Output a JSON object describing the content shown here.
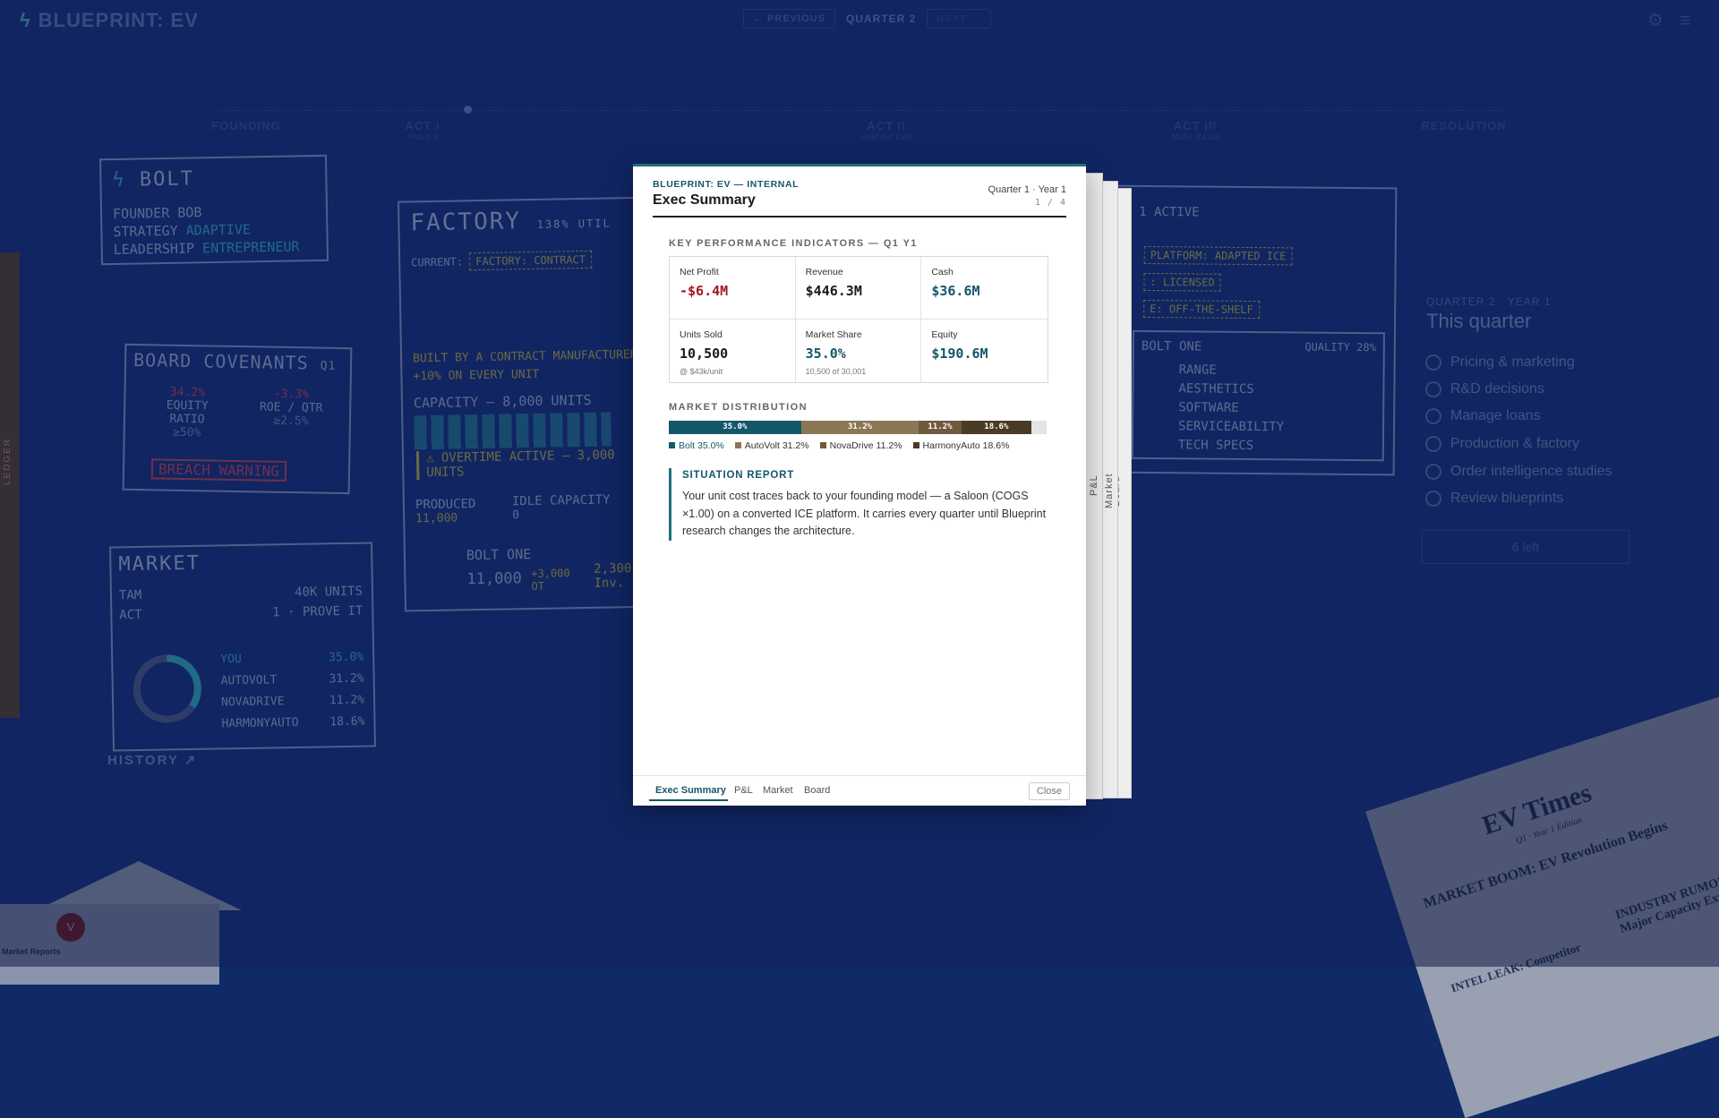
{
  "brand": {
    "name": "BLUEPRINT: EV"
  },
  "topnav": {
    "previous": "← PREVIOUS",
    "quarter": "QUARTER 2",
    "next": "NEXT →"
  },
  "timeline": [
    {
      "label": "FOUNDING",
      "sub": ""
    },
    {
      "label": "ACT I",
      "sub": "Prove It"
    },
    {
      "label": "ACT II",
      "sub": "Hold the Line"
    },
    {
      "label": "ACT III",
      "sub": "Make It Last"
    },
    {
      "label": "RESOLUTION",
      "sub": ""
    }
  ],
  "ledger": {
    "label": "LEDGER"
  },
  "bolt_card": {
    "name": "BOLT",
    "founder_label": "FOUNDER",
    "founder": "BOB",
    "strategy_label": "STRATEGY",
    "strategy": "ADAPTIVE",
    "leadership_label": "LEADERSHIP",
    "leadership": "ENTREPRENEUR"
  },
  "covenants": {
    "title": "BOARD COVENANTS",
    "quarter": "Q1",
    "equity_ratio": "34.2%",
    "equity_label": "EQUITY RATIO",
    "equity_req": "≥50%",
    "roe": "-3.3%",
    "roe_label": "ROE / QTR",
    "roe_req": "≥2.5%",
    "warning": "BREACH WARNING"
  },
  "factory": {
    "title": "FACTORY",
    "util": "138% UTIL",
    "current_label": "CURRENT:",
    "current": "FACTORY: CONTRACT",
    "built_by": "BUILT BY A CONTRACT MANUFACTURER",
    "surcharge": "+10% ON EVERY UNIT",
    "capacity": "CAPACITY — 8,000 UNITS",
    "overtime": "OVERTIME ACTIVE — 3,000 UNITS",
    "produced_label": "PRODUCED",
    "produced": "11,000",
    "idle_label": "IDLE CAPACITY",
    "idle": "0",
    "product": "BOLT ONE",
    "product_units": "11,000",
    "ot": "+3,000 OT",
    "inv": "2,300 Inv."
  },
  "market_card": {
    "title": "MARKET",
    "tam_label": "TAM",
    "tam": "40K UNITS",
    "act_label": "ACT",
    "act": "1 · PROVE IT",
    "rows": [
      {
        "name": "YOU",
        "share": "35.0%"
      },
      {
        "name": "AUTOVOLT",
        "share": "31.2%"
      },
      {
        "name": "NOVADRIVE",
        "share": "11.2%"
      },
      {
        "name": "HARMONYAUTO",
        "share": "18.6%"
      }
    ],
    "history": "HISTORY ↗"
  },
  "product_card": {
    "active": "1 ACTIVE",
    "platform": "PLATFORM: ADAPTED ICE",
    "licensed": ": LICENSED",
    "shelf": "E: OFF-THE-SHELF",
    "name": "BOLT ONE",
    "quality": "QUALITY 28%",
    "attrs": [
      "RANGE",
      "AESTHETICS",
      "SOFTWARE",
      "SERVICEABILITY",
      "TECH SPECS"
    ]
  },
  "right_panel": {
    "kicker": "QUARTER 2 · YEAR 1",
    "title": "This quarter",
    "items": [
      "Pricing & marketing",
      "R&D decisions",
      "Manage loans",
      "Production & factory",
      "Order intelligence studies",
      "Review blueprints"
    ],
    "remaining": "6 left"
  },
  "newspaper": {
    "title": "EV Times",
    "edition": "Q1 · Year 1 Edition",
    "headline": "MARKET BOOM: EV Revolution Begins",
    "headline2": "INDUSTRY RUMOUR: Major Capacity Expansion",
    "headline3": "INTEL LEAK: Competitor"
  },
  "envelope": {
    "seal": "V",
    "label": "Market Reports"
  },
  "modal": {
    "kicker": "BLUEPRINT: EV — INTERNAL",
    "title": "Exec Summary",
    "period": "Quarter 1 · Year 1",
    "page": "1 / 4",
    "kpi_title": "KEY PERFORMANCE INDICATORS — Q1 Y1",
    "kpis": [
      {
        "label": "Net Profit",
        "value": "-$6.4M",
        "note": "",
        "color": "#a3161f"
      },
      {
        "label": "Revenue",
        "value": "$446.3M",
        "note": "",
        "color": "#1a1a1a"
      },
      {
        "label": "Cash",
        "value": "$36.6M",
        "note": "",
        "color": "#15576a"
      },
      {
        "label": "Units Sold",
        "value": "10,500",
        "note": "@ $43k/unit",
        "color": "#1a1a1a"
      },
      {
        "label": "Market Share",
        "value": "35.0%",
        "note": "10,500 of 30,001",
        "color": "#15576a"
      },
      {
        "label": "Equity",
        "value": "$190.6M",
        "note": "",
        "color": "#15576a"
      }
    ],
    "dist_title": "MARKET DISTRIBUTION",
    "distribution": [
      {
        "name": "Bolt",
        "share": 35.0,
        "label": "35.0%",
        "legend": "Bolt 35.0%",
        "color": "#15576a"
      },
      {
        "name": "AutoVolt",
        "share": 31.2,
        "label": "31.2%",
        "legend": "AutoVolt 31.2%",
        "color": "#8a7753"
      },
      {
        "name": "NovaDrive",
        "share": 11.2,
        "label": "11.2%",
        "legend": "NovaDrive 11.2%",
        "color": "#6e5a3c"
      },
      {
        "name": "HarmonyAuto",
        "share": 18.6,
        "label": "18.6%",
        "legend": "HarmonyAuto 18.6%",
        "color": "#4a3b26"
      }
    ],
    "situation_title": "SITUATION REPORT",
    "situation_body": "Your unit cost traces back to your founding model — a Saloon (COGS ×1.00) on a converted ICE platform. It carries every quarter until Blueprint research changes the architecture.",
    "footer_tabs": [
      "Exec Summary",
      "P&L",
      "Market",
      "Board"
    ],
    "close": "Close",
    "back_tabs": [
      "P&L",
      "Market",
      "Board"
    ]
  }
}
